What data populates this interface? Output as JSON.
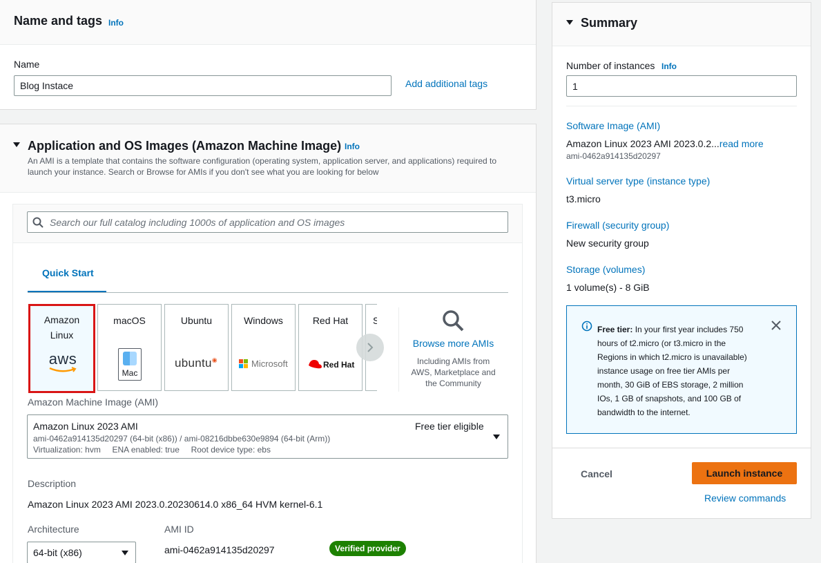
{
  "name_tags": {
    "title": "Name and tags",
    "info": "Info",
    "name_label": "Name",
    "name_value": "Blog Instace",
    "add_tags": "Add additional tags"
  },
  "ami_section": {
    "title": "Application and OS Images (Amazon Machine Image)",
    "info": "Info",
    "description_line1": "An AMI is a template that contains the software configuration (operating system, application server, and applications) required to",
    "description_line2": "launch your instance. Search or Browse for AMIs if you don't see what you are looking for below",
    "search_placeholder": "Search our full catalog including 1000s of application and OS images",
    "tab": "Quick Start",
    "tiles": [
      {
        "name_line1": "Amazon",
        "name_line2": "Linux",
        "logo": "aws"
      },
      {
        "name_line1": "macOS",
        "logo_text": "Mac"
      },
      {
        "name_line1": "Ubuntu",
        "logo_text": "ubuntu"
      },
      {
        "name_line1": "Windows",
        "logo_text": "Microsoft"
      },
      {
        "name_line1": "Red Hat",
        "logo_text": "Red Hat"
      },
      {
        "name_line1": "S"
      }
    ],
    "browse_more": "Browse more AMIs",
    "browse_desc_1": "Including AMIs from",
    "browse_desc_2": "AWS, Marketplace and",
    "browse_desc_3": "the Community",
    "ami_label": "Amazon Machine Image (AMI)",
    "ami_selected": {
      "name": "Amazon Linux 2023 AMI",
      "badge": "Free tier eligible",
      "ids": "ami-0462a914135d20297 (64-bit (x86)) / ami-08216dbbe630e9894 (64-bit (Arm))",
      "details": "Virtualization: hvm     ENA enabled: true     Root device type: ebs"
    },
    "description_label": "Description",
    "description_value": "Amazon Linux 2023 AMI 2023.0.20230614.0 x86_64 HVM kernel-6.1",
    "architecture_label": "Architecture",
    "architecture_value": "64-bit (x86)",
    "ami_id_label": "AMI ID",
    "ami_id_value": "ami-0462a914135d20297",
    "verified": "Verified provider"
  },
  "summary": {
    "title": "Summary",
    "num_instances_label": "Number of instances",
    "info": "Info",
    "num_instances_value": "1",
    "software_image_label": "Software Image (AMI)",
    "software_image_value": "Amazon Linux 2023 AMI 2023.0.2...",
    "read_more": "read more",
    "software_image_id": "ami-0462a914135d20297",
    "server_type_label": "Virtual server type (instance type)",
    "server_type_value": "t3.micro",
    "firewall_label": "Firewall (security group)",
    "firewall_value": "New security group",
    "storage_label": "Storage (volumes)",
    "storage_value": "1 volume(s) - 8 GiB",
    "free_tier_bold": "Free tier:",
    "free_tier_lines": [
      "In your first year includes 750",
      "hours of t2.micro (or t3.micro in the",
      "Regions in which t2.micro is unavailable)",
      "instance usage on free tier AMIs per",
      "month, 30 GiB of EBS storage, 2 million",
      "IOs, 1 GB of snapshots, and 100 GB of",
      "bandwidth to the internet."
    ],
    "cancel": "Cancel",
    "launch": "Launch instance",
    "review": "Review commands"
  },
  "colors": {
    "accent": "#0073bb",
    "launch": "#ec7211",
    "selected_outline": "#d91515",
    "verified_bg": "#1d8102"
  }
}
